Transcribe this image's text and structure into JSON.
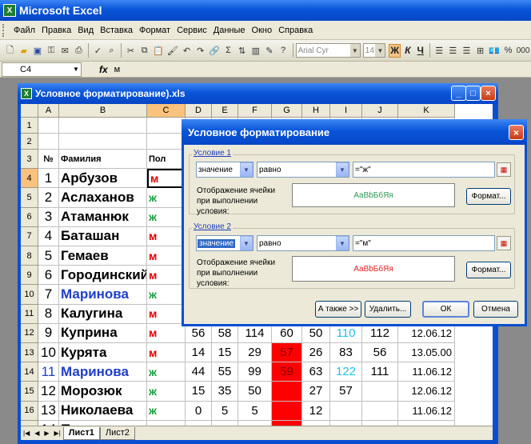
{
  "app": {
    "title": "Microsoft Excel"
  },
  "menu": [
    "Файл",
    "Правка",
    "Вид",
    "Вставка",
    "Формат",
    "Сервис",
    "Данные",
    "Окно",
    "Справка"
  ],
  "toolbar": {
    "font_name": "Arial Cyr",
    "font_size": "14"
  },
  "formula_bar": {
    "name_box": "C4",
    "fx": "fx",
    "content": "м"
  },
  "workbook": {
    "title": "Условное форматирование).xls"
  },
  "columns": [
    "A",
    "B",
    "C",
    "D",
    "E",
    "F",
    "G",
    "H",
    "I",
    "J",
    "K"
  ],
  "header_row": {
    "a": "№",
    "b": "Фамилия",
    "c": "Пол"
  },
  "rows": [
    {
      "r": "1",
      "a": "",
      "b": "",
      "c": "",
      "d": "",
      "e": "",
      "f": "",
      "g": "",
      "h": "",
      "i": "",
      "j": "",
      "k": ""
    },
    {
      "r": "2",
      "a": "",
      "b": "",
      "c": "",
      "d": "",
      "e": "",
      "f": "",
      "g": "",
      "h": "",
      "i": "",
      "j": "",
      "k": ""
    },
    {
      "r": "3",
      "a": "№",
      "b": "Фамилия",
      "c": "Пол",
      "d": "",
      "e": "",
      "f": "",
      "g": "",
      "h": "",
      "i": "",
      "j": "",
      "k": ""
    },
    {
      "r": "4",
      "a": "1",
      "b": "Арбузов",
      "c": "м",
      "d": "",
      "e": "",
      "f": "",
      "g": "",
      "h": "",
      "i": "",
      "j": "",
      "k": ""
    },
    {
      "r": "5",
      "a": "2",
      "b": "Аслаханов",
      "c": "ж",
      "d": "",
      "e": "",
      "f": "",
      "g": "",
      "h": "",
      "i": "",
      "j": "",
      "k": ""
    },
    {
      "r": "6",
      "a": "3",
      "b": "Атаманюк",
      "c": "ж",
      "d": "",
      "e": "",
      "f": "",
      "g": "",
      "h": "",
      "i": "",
      "j": "",
      "k": ""
    },
    {
      "r": "7",
      "a": "4",
      "b": "Баташан",
      "c": "м",
      "d": "",
      "e": "",
      "f": "",
      "g": "",
      "h": "",
      "i": "",
      "j": "",
      "k": ""
    },
    {
      "r": "8",
      "a": "5",
      "b": "Гемаев",
      "c": "м",
      "d": "",
      "e": "",
      "f": "",
      "g": "",
      "h": "",
      "i": "",
      "j": "",
      "k": ""
    },
    {
      "r": "9",
      "a": "6",
      "b": "Городинский",
      "c": "м",
      "d": "",
      "e": "",
      "f": "",
      "g": "",
      "h": "",
      "i": "",
      "j": "",
      "k": ""
    },
    {
      "r": "10",
      "a": "7",
      "b": "Маринова",
      "c": "ж",
      "d": "",
      "e": "",
      "f": "",
      "g": "",
      "h": "",
      "i": "",
      "j": "",
      "k": ""
    },
    {
      "r": "11",
      "a": "8",
      "b": "Калугина",
      "c": "м",
      "d": "",
      "e": "",
      "f": "",
      "g": "",
      "h": "",
      "i": "",
      "j": "",
      "k": ""
    },
    {
      "r": "12",
      "a": "9",
      "b": "Куприна",
      "c": "м",
      "d": "56",
      "e": "58",
      "f": "114",
      "g": "60",
      "h": "50",
      "i": "110",
      "j": "112",
      "k": "12.06.12"
    },
    {
      "r": "13",
      "a": "10",
      "b": "Курята",
      "c": "м",
      "d": "14",
      "e": "15",
      "f": "29",
      "g": "57",
      "h": "26",
      "i": "83",
      "j": "56",
      "k": "13.05.00"
    },
    {
      "r": "14",
      "a": "11",
      "b": "Маринова",
      "c": "ж",
      "d": "44",
      "e": "55",
      "f": "99",
      "g": "59",
      "h": "63",
      "i": "122",
      "j": "111",
      "k": "11.06.12"
    },
    {
      "r": "15",
      "a": "12",
      "b": "Морозюк",
      "c": "ж",
      "d": "15",
      "e": "35",
      "f": "50",
      "g": "",
      "h": "27",
      "i": "57",
      "j": "",
      "k": "12.06.12"
    },
    {
      "r": "16",
      "a": "13",
      "b": "Николаева",
      "c": "ж",
      "d": "0",
      "e": "5",
      "f": "5",
      "g": "",
      "h": "12",
      "i": "",
      "j": "",
      "k": "11.06.12"
    },
    {
      "r": "17",
      "a": "14",
      "b": "П...",
      "c": "",
      "d": "",
      "e": "",
      "f": "",
      "g": "",
      "h": "",
      "i": "",
      "j": "",
      "k": ""
    }
  ],
  "sheets": [
    "Лист1",
    "Лист2"
  ],
  "colors": {
    "male": "#e00000",
    "female": "#1aa040",
    "blue_name": "#1f3fc9",
    "cyan": "#22c0e8",
    "red_fill": "#ff0000",
    "selection": "#fac27d"
  },
  "dialog": {
    "title": "Условное форматирование",
    "condition1": {
      "label": "Условие 1",
      "type": "значение",
      "operator": "равно",
      "value": "=\"ж\"",
      "preview_label": "Отображение ячейки при выполнении условия:",
      "preview_text": "АаВbБбЯя",
      "preview_color": "#2e9a50",
      "format_button": "Формат..."
    },
    "condition2": {
      "label": "Условие 2",
      "type": "значение",
      "operator": "равно",
      "value": "=\"м\"",
      "preview_label": "Отображение ячейки при выполнении условия:",
      "preview_text": "АаВbБбЯя",
      "preview_color": "#e02020",
      "format_button": "Формат..."
    },
    "buttons": {
      "also": "А также >>",
      "delete": "Удалить...",
      "ok": "ОК",
      "cancel": "Отмена"
    }
  }
}
